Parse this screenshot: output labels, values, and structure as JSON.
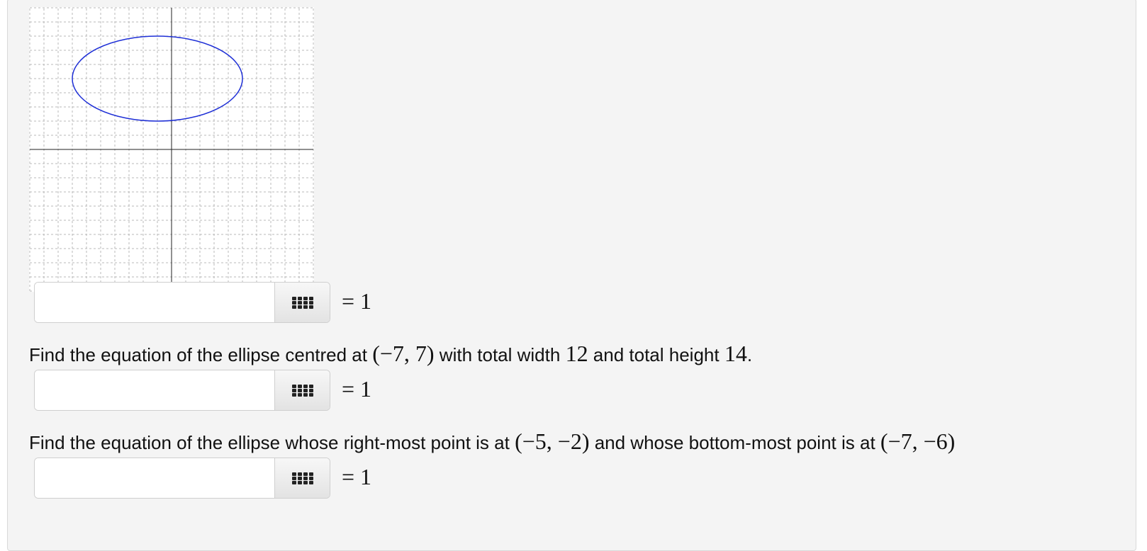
{
  "graph": {
    "x_range": [
      -10,
      10
    ],
    "y_range": [
      -10,
      10
    ],
    "grid_step": 1,
    "ellipse": {
      "center": [
        -1,
        5
      ],
      "rx": 6,
      "ry": 3,
      "color": "#1e2fd6"
    }
  },
  "problems": [
    {
      "prompt_parts": [],
      "answer_value": "",
      "rhs": "= 1"
    },
    {
      "prompt_parts": [
        {
          "t": "Find the equation of the ellipse centred at ",
          "m": false
        },
        {
          "t": "(−7, 7)",
          "m": true
        },
        {
          "t": " with total width ",
          "m": false
        },
        {
          "t": "12",
          "m": true
        },
        {
          "t": " and total height ",
          "m": false
        },
        {
          "t": "14",
          "m": true
        },
        {
          "t": ".",
          "m": false
        }
      ],
      "answer_value": "",
      "rhs": "= 1"
    },
    {
      "prompt_parts": [
        {
          "t": "Find the equation of the ellipse whose right-most point is at ",
          "m": false
        },
        {
          "t": "(−5, −2)",
          "m": true
        },
        {
          "t": " and whose bottom-most point is at ",
          "m": false
        },
        {
          "t": "(−7, −6)",
          "m": true
        }
      ],
      "answer_value": "",
      "rhs": "= 1"
    }
  ]
}
